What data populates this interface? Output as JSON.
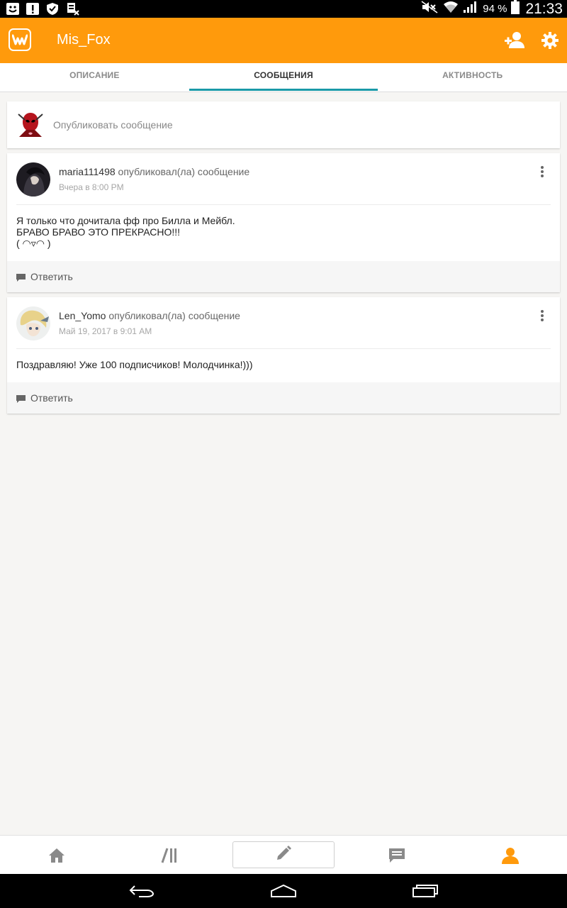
{
  "status_bar": {
    "battery_percent": "94 %",
    "time": "21:33",
    "icons": [
      "notification-face-icon",
      "alert-icon",
      "shield-icon",
      "sim-icon",
      "mute-icon",
      "wifi-icon",
      "signal-icon",
      "battery-icon"
    ]
  },
  "app_bar": {
    "logo_icon": "wattpad-logo-icon",
    "title": "Mis_Fox",
    "add_user_icon": "add-user-icon",
    "settings_icon": "gear-icon",
    "color": "#ff9a0c"
  },
  "tabs": [
    {
      "label": "ОПИСАНИЕ",
      "active": false
    },
    {
      "label": "СООБЩЕНИЯ",
      "active": true
    },
    {
      "label": "АКТИВНОСТЬ",
      "active": false
    }
  ],
  "compose": {
    "placeholder": "Опубликовать сообщение"
  },
  "posts": [
    {
      "author": "maria111498",
      "action": "опубликовал(ла) сообщение",
      "time": "Вчера в 8:00 PM",
      "lines": [
        "Я только что дочитала фф про Билла и Мейбл.",
        "БРАВО БРАВО ЭТО ПРЕКРАСНО!!!",
        "( ◠▿◠ )"
      ],
      "reply_label": "Ответить"
    },
    {
      "author": "Len_Yomo",
      "action": "опубликовал(ла) сообщение",
      "time": "Май 19, 2017 в 9:01 AM",
      "lines": [
        "Поздравляю! Уже 100 подписчиков! Молодчинка!)))"
      ],
      "reply_label": "Ответить"
    }
  ],
  "bottom_nav": {
    "items": [
      "home-icon",
      "library-icon",
      "pencil-icon",
      "messages-icon",
      "profile-icon"
    ],
    "active": "profile-icon",
    "accent": "#ff9a0c"
  },
  "system_nav": [
    "back-icon",
    "home-outline-icon",
    "recents-icon"
  ]
}
